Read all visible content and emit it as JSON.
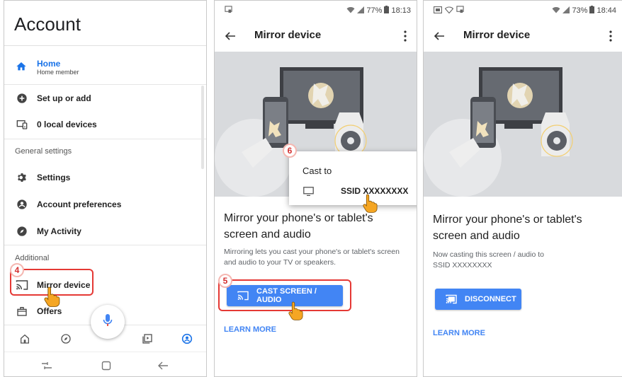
{
  "account_panel": {
    "title": "Account",
    "home": {
      "title": "Home",
      "subtitle": "Home member"
    },
    "items": [
      {
        "label": "Set up or add"
      },
      {
        "label": "0 local devices"
      }
    ],
    "general_settings_label": "General settings",
    "general_items": [
      {
        "label": "Settings"
      },
      {
        "label": "Account preferences"
      },
      {
        "label": "My Activity"
      }
    ],
    "additional_label": "Additional",
    "additional_items": [
      {
        "label": "Mirror device"
      },
      {
        "label": "Offers"
      }
    ]
  },
  "mirror_panel_1": {
    "status": {
      "battery": "77%",
      "time": "18:13"
    },
    "title": "Mirror device",
    "heading": "Mirror your phone's or tablet's screen and audio",
    "description": "Mirroring lets you cast your phone's or tablet's screen and audio to your TV or speakers.",
    "cast_button_label": "CAST SCREEN / AUDIO",
    "learn_more": "LEARN MORE",
    "cast_dialog": {
      "title": "Cast to",
      "device_name": "SSID XXXXXXXX"
    }
  },
  "mirror_panel_2": {
    "status": {
      "battery": "73%",
      "time": "18:44"
    },
    "title": "Mirror device",
    "heading": "Mirror your phone's or tablet's screen and audio",
    "casting_text": "Now casting this screen / audio to",
    "casting_device": "SSID XXXXXXXX",
    "disconnect_label": "DISCONNECT",
    "learn_more": "LEARN MORE"
  },
  "step_badges": [
    "4",
    "5",
    "6"
  ],
  "colors": {
    "accent_blue": "#4285f4",
    "link_blue": "#1a73e8",
    "annotation_red": "#e53935",
    "hero_gray": "#d8dadd",
    "cursor_orange": "#f5a623"
  }
}
